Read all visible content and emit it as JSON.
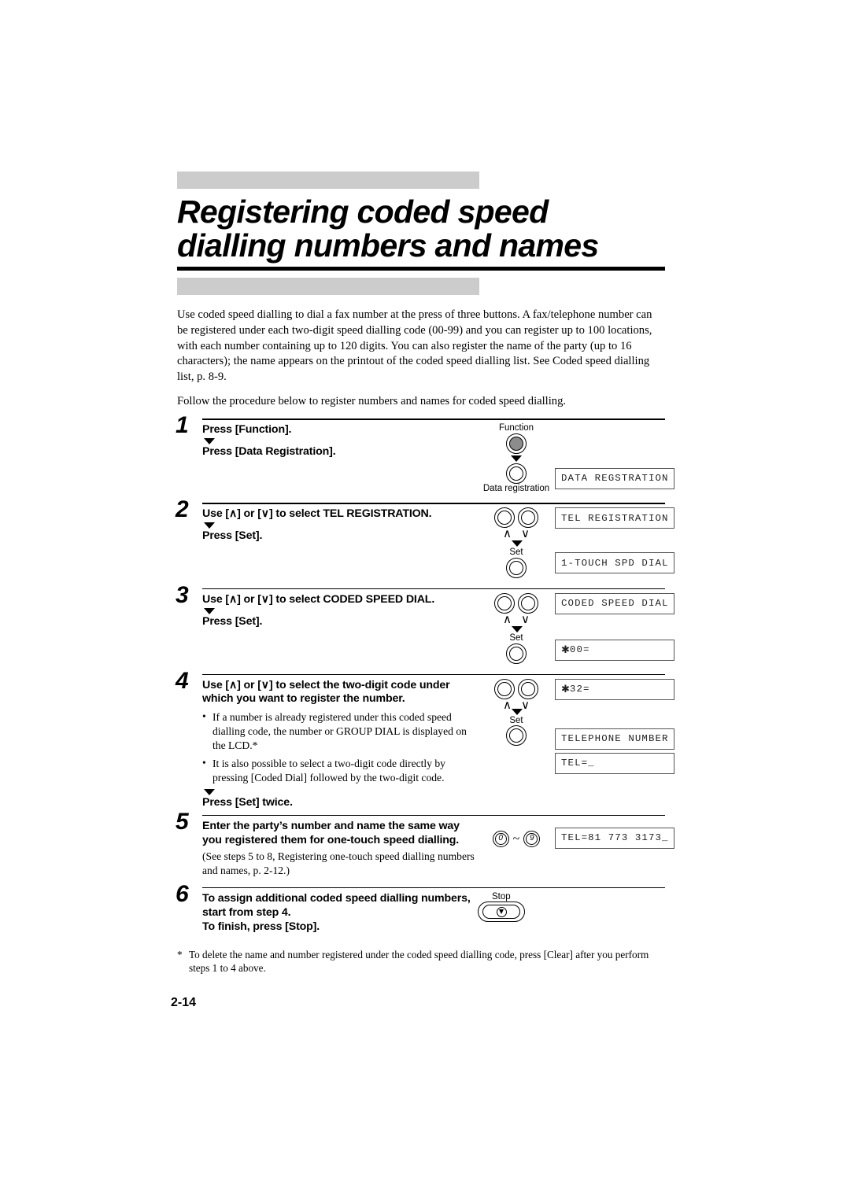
{
  "header": {
    "title": "Registering coded speed dialling numbers and names"
  },
  "intro": {
    "paragraph1": "Use coded speed dialling to dial a fax number at the press of three buttons. A fax/telephone number can be registered under each two-digit speed dialling code (00-99) and you can register up to 100 locations, with each number containing up to 120 digits. You can also register the name of the party (up to 16 characters); the name appears on the printout of the coded speed dialling list. See Coded speed dialling list, p. 8-9.",
    "paragraph2": "Follow the procedure below to register numbers and names for coded speed dialling."
  },
  "steps": {
    "s1": {
      "num": "1",
      "line1": "Press [Function].",
      "line2": "Press [Data Registration].",
      "key1_label": "Function",
      "key2_label": "Data registration",
      "lcd1": "DATA REGSTRATION"
    },
    "s2": {
      "num": "2",
      "line1": "Use [∧] or [∨] to select TEL REGISTRATION.",
      "line2": "Press [Set].",
      "up_glyph": "∧",
      "down_glyph": "∨",
      "set_label": "Set",
      "lcd1": "TEL REGISTRATION",
      "lcd2": "1-TOUCH SPD DIAL"
    },
    "s3": {
      "num": "3",
      "line1": "Use [∧] or [∨] to select CODED SPEED DIAL.",
      "line2": "Press [Set].",
      "up_glyph": "∧",
      "down_glyph": "∨",
      "set_label": "Set",
      "lcd1": "CODED SPEED DIAL",
      "lcd2_asterisk": "✱",
      "lcd2_rest": "00="
    },
    "s4": {
      "num": "4",
      "line1": "Use [∧] or [∨] to select the two-digit code under which you want to register the number.",
      "bullet1": "If a number is already registered under this coded speed dialling code, the number or GROUP DIAL is displayed on the LCD.*",
      "bullet2": "It is also possible to select a two-digit code directly by pressing [Coded Dial] followed by the two-digit code.",
      "line2": "Press [Set] twice.",
      "up_glyph": "∧",
      "down_glyph": "∨",
      "set_label": "Set",
      "lcd1_asterisk": "✱",
      "lcd1_rest": "32=",
      "lcd2": "TELEPHONE NUMBER",
      "lcd3": "TEL=_"
    },
    "s5": {
      "num": "5",
      "line1": "Enter the party’s number and name the same way you registered them for one-touch speed dialling.",
      "note": "(See steps 5 to 8, Registering one-touch speed dialling numbers and names, p. 2-12.)",
      "key_from": "0",
      "key_to": "9",
      "key_tilde": "~",
      "lcd1": "TEL=81 773 3173_"
    },
    "s6": {
      "num": "6",
      "line1": "To assign additional coded speed dialling numbers, start from step 4.",
      "line2": "To finish, press [Stop].",
      "key_label": "Stop"
    }
  },
  "footnote": "To delete the name and number registered under the coded speed dialling code, press [Clear] after you perform steps 1 to 4 above.",
  "page_number": "2-14"
}
